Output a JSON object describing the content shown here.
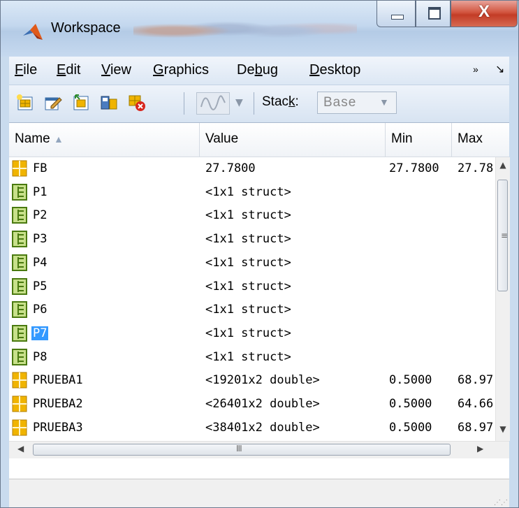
{
  "window": {
    "title": "Workspace",
    "close_glyph": "X"
  },
  "menubar": {
    "items": [
      {
        "pre": "",
        "acc": "F",
        "post": "ile"
      },
      {
        "pre": "",
        "acc": "E",
        "post": "dit"
      },
      {
        "pre": "",
        "acc": "V",
        "post": "iew"
      },
      {
        "pre": "",
        "acc": "G",
        "post": "raphics"
      },
      {
        "pre": "De",
        "acc": "b",
        "post": "ug"
      },
      {
        "pre": "",
        "acc": "D",
        "post": "esktop"
      }
    ],
    "overflow_glyph": "»",
    "dock_glyph": "↘"
  },
  "toolbar": {
    "stack_label_pre": "Stac",
    "stack_label_acc": "k",
    "stack_label_post": ":",
    "stack_value": "Base",
    "icons": [
      "new-variable-icon",
      "open-variable-icon",
      "import-data-icon",
      "save-workspace-icon",
      "delete-variable-icon",
      "plot-selection-icon"
    ]
  },
  "table": {
    "columns": {
      "name": "Name",
      "value": "Value",
      "min": "Min",
      "max": "Max"
    },
    "sort_glyph": "▲",
    "rows": [
      {
        "name": "FB",
        "value": "27.7800",
        "min": "27.7800",
        "max": "27.78",
        "type": "matrix"
      },
      {
        "name": "P1",
        "value": "<1x1 struct>",
        "min": "",
        "max": "",
        "type": "struct"
      },
      {
        "name": "P2",
        "value": "<1x1 struct>",
        "min": "",
        "max": "",
        "type": "struct"
      },
      {
        "name": "P3",
        "value": "<1x1 struct>",
        "min": "",
        "max": "",
        "type": "struct"
      },
      {
        "name": "P4",
        "value": "<1x1 struct>",
        "min": "",
        "max": "",
        "type": "struct"
      },
      {
        "name": "P5",
        "value": "<1x1 struct>",
        "min": "",
        "max": "",
        "type": "struct"
      },
      {
        "name": "P6",
        "value": "<1x1 struct>",
        "min": "",
        "max": "",
        "type": "struct"
      },
      {
        "name": "P7",
        "value": "<1x1 struct>",
        "min": "",
        "max": "",
        "type": "struct",
        "selected": true
      },
      {
        "name": "P8",
        "value": "<1x1 struct>",
        "min": "",
        "max": "",
        "type": "struct"
      },
      {
        "name": "PRUEBA1",
        "value": "<19201x2 double>",
        "min": "0.5000",
        "max": "68.97",
        "type": "matrix"
      },
      {
        "name": "PRUEBA2",
        "value": "<26401x2 double>",
        "min": "0.5000",
        "max": "64.66",
        "type": "matrix"
      },
      {
        "name": "PRUEBA3",
        "value": "<38401x2 double>",
        "min": "0.5000",
        "max": "68.97",
        "type": "matrix"
      }
    ]
  },
  "scrollbars": {
    "up": "▲",
    "down": "▼",
    "left": "◀",
    "right": "▶",
    "grip_v": "≡",
    "grip_h": "III"
  },
  "colors": {
    "selection": "#3399ff",
    "matrix_icon": "#f0b400",
    "struct_icon": "#6a9a1e"
  }
}
